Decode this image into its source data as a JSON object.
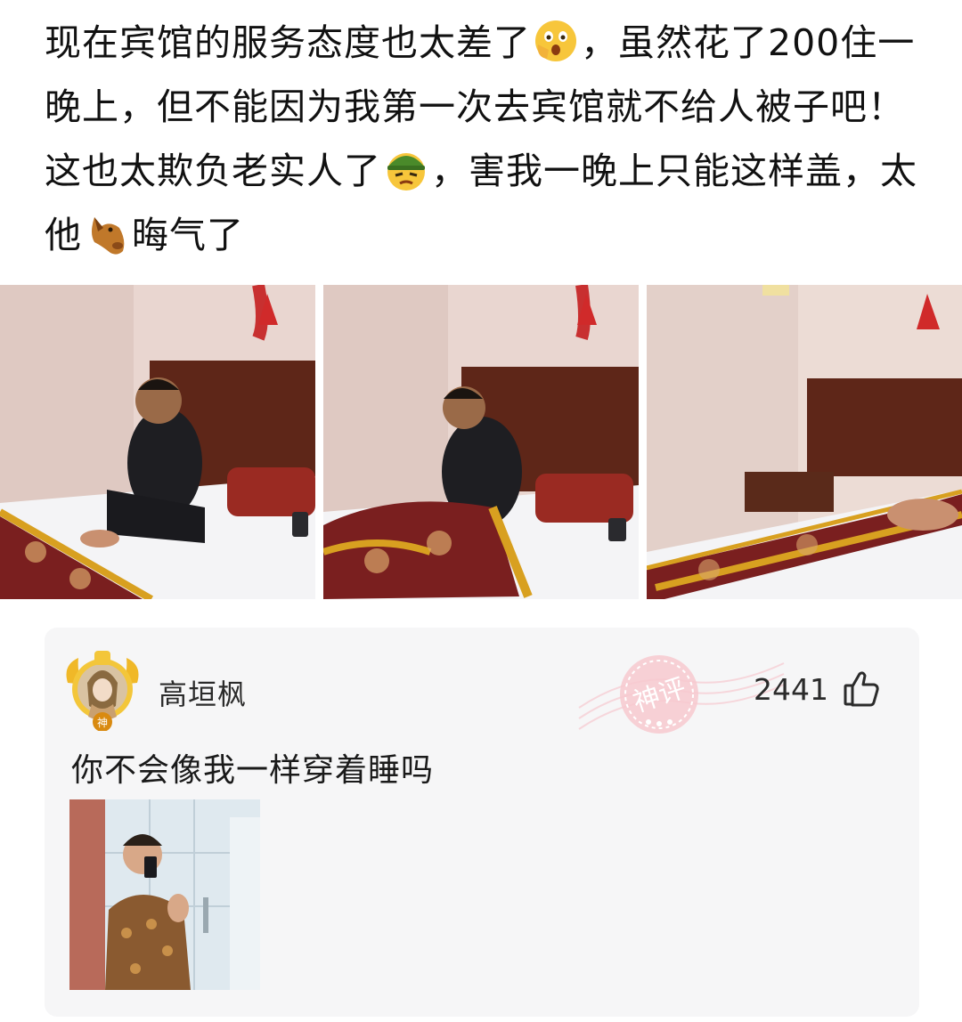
{
  "post": {
    "segment_1": "现在宾馆的服务态度也太差了",
    "segment_2": "，虽然花了200住一晚上，但不能因为我第一次去宾馆就不给人被子吧！这也太欺负老实人了",
    "segment_3": "，害我一晚上只能这样盖，太他",
    "segment_4": "晦气了",
    "emojis": [
      "shocked-face-emoji",
      "soldier-face-emoji",
      "horse-face-emoji"
    ]
  },
  "photos": [
    "hotel-bed-photo-sitting",
    "hotel-bed-photo-wrapping",
    "hotel-bed-photo-lying"
  ],
  "comment": {
    "username": "高垣枫",
    "avatar_badge": "神",
    "stamp_text": "神评",
    "like_count": "2441",
    "text": "你不会像我一样穿着睡吗",
    "icons": [
      "avatar-icon",
      "thumbs-up-icon"
    ]
  },
  "colors": {
    "stamp": "#f2b8c0",
    "bed_runner": "#7a1f1f",
    "gold_trim": "#d8a020",
    "wall": "#e8d3cd",
    "headboard": "#5a2418"
  }
}
